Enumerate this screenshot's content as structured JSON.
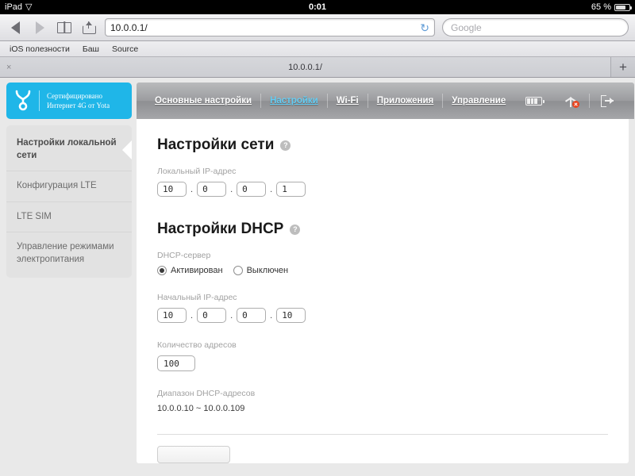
{
  "status_bar": {
    "device": "iPad",
    "wifi_icon": "wifi-icon",
    "time": "0:01",
    "battery_percent": "65 %"
  },
  "safari": {
    "back_icon": "back-arrow-icon",
    "forward_icon": "forward-arrow-icon",
    "bookmarks_icon": "book-icon",
    "share_icon": "share-icon",
    "url": "10.0.0.1/",
    "reload_icon": "reload-icon",
    "reload_glyph": "↻",
    "search_placeholder": "Google",
    "bookmarks": [
      {
        "label": "iOS полезности"
      },
      {
        "label": "Баш"
      },
      {
        "label": "Source"
      }
    ],
    "tabs": [
      {
        "title": "10.0.0.1/",
        "close_glyph": "×"
      }
    ],
    "new_tab_glyph": "+"
  },
  "router_ui": {
    "logo": {
      "mark_icon": "yota-logo-icon",
      "line1": "Сертифицировано",
      "line2": "Интернет 4G от Yota",
      "brand_color": "#1fb6e8"
    },
    "nav": {
      "active_color": "#63cdf4",
      "items": [
        {
          "label": "Основные настройки",
          "active": false
        },
        {
          "label": "Настройки",
          "active": true
        },
        {
          "label": "Wi-Fi",
          "active": false
        },
        {
          "label": "Приложения",
          "active": false
        },
        {
          "label": "Управление",
          "active": false
        }
      ],
      "battery_icon": "battery-icon",
      "signal_icon": "signal-error-icon",
      "logout_icon": "logout-icon",
      "error_dot_color": "#e8441f"
    },
    "sidebar": {
      "items": [
        {
          "label": "Настройки локальной сети",
          "active": true
        },
        {
          "label": "Конфигурация LTE",
          "active": false
        },
        {
          "label": "LTE SIM",
          "active": false
        },
        {
          "label": "Управление режимами электропитания",
          "active": false
        }
      ]
    },
    "network_section": {
      "title": "Настройки сети",
      "help_glyph": "?",
      "local_ip_label": "Локальный IP-адрес",
      "local_ip": [
        "10",
        "0",
        "0",
        "1"
      ],
      "dot": "."
    },
    "dhcp_section": {
      "title": "Настройки DHCP",
      "help_glyph": "?",
      "server_label": "DHCP-сервер",
      "radio_options": [
        {
          "label": "Активирован",
          "selected": true
        },
        {
          "label": "Выключен",
          "selected": false
        }
      ],
      "start_ip_label": "Начальный IP-адрес",
      "start_ip": [
        "10",
        "0",
        "0",
        "10"
      ],
      "count_label": "Количество адресов",
      "count_value": "100",
      "range_label": "Диапазон DHCP-адресов",
      "range_value": "10.0.0.10  ~  10.0.0.109"
    }
  }
}
